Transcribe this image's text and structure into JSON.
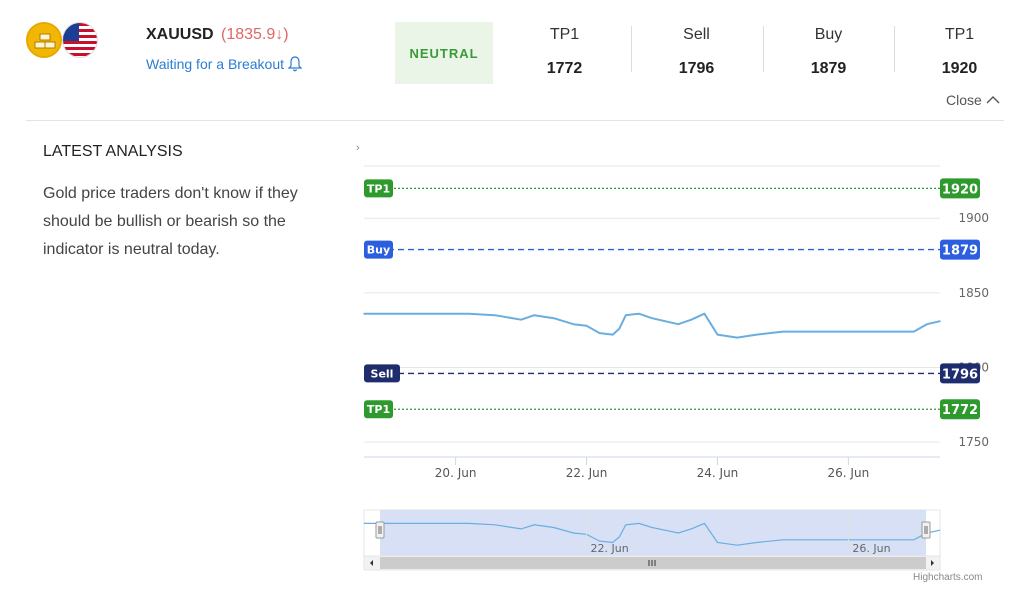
{
  "instrument": {
    "pair": "XAUUSD",
    "price": "(1835.9↓)",
    "status": "Waiting for a Breakout",
    "signal": "NEUTRAL"
  },
  "levels": [
    {
      "label": "TP1",
      "value": "1772"
    },
    {
      "label": "Sell",
      "value": "1796"
    },
    {
      "label": "Buy",
      "value": "1879"
    },
    {
      "label": "TP1",
      "value": "1920"
    }
  ],
  "close_label": "Close",
  "analysis": {
    "title": "LATEST ANALYSIS",
    "text": "Gold price traders don't know if they should be bullish or bearish so the indicator is neutral today."
  },
  "colors": {
    "gold_flag": "#f2b705",
    "price_down": "#e06666",
    "link": "#2a7dd1",
    "neutral_bg": "#eaf4e7",
    "neutral_text": "#3a9a3a",
    "tp_green": "#2e9a2e",
    "buy_blue": "#2b5fe0",
    "sell_navy": "#1f2d6e",
    "series": "#6aaee0"
  },
  "credit": "Highcharts.com",
  "chart_data": {
    "type": "line",
    "x_ticks": [
      "20. Jun",
      "22. Jun",
      "24. Jun",
      "26. Jun"
    ],
    "nav_ticks": [
      "22. Jun",
      "26. Jun"
    ],
    "y_ticks": [
      "1750",
      "1800",
      "1850",
      "1900"
    ],
    "ylim": [
      1740,
      1935
    ],
    "series": [
      {
        "x": [
          18.6,
          19.5,
          20.2,
          20.6,
          21.0,
          21.2,
          21.5,
          21.8,
          22.0,
          22.2,
          22.4,
          22.5,
          22.6,
          22.8,
          23.0,
          23.2,
          23.4,
          23.6,
          23.8,
          24.0,
          24.3,
          24.6,
          25.0,
          25.5,
          26.0,
          26.5,
          27.0,
          27.2,
          27.4
        ],
        "y": [
          1836,
          1836,
          1836,
          1835,
          1832,
          1835,
          1833,
          1829,
          1828,
          1823,
          1822,
          1826,
          1835,
          1836,
          1833,
          1831,
          1829,
          1832,
          1836,
          1822,
          1820,
          1822,
          1824,
          1824,
          1824,
          1824,
          1824,
          1829,
          1831
        ]
      }
    ],
    "horizontal_lines": [
      {
        "label": "TP1",
        "value": 1920,
        "value_label": "1920",
        "color": "#2e9a2e",
        "style": "dotted"
      },
      {
        "label": "Buy",
        "value": 1879,
        "value_label": "1879",
        "color": "#2b5fe0",
        "style": "dashed"
      },
      {
        "label": "Sell",
        "value": 1796,
        "value_label": "1796",
        "color": "#1f2d6e",
        "style": "dashed"
      },
      {
        "label": "TP1",
        "value": 1772,
        "value_label": "1772",
        "color": "#2e9a2e",
        "style": "dotted"
      }
    ]
  }
}
